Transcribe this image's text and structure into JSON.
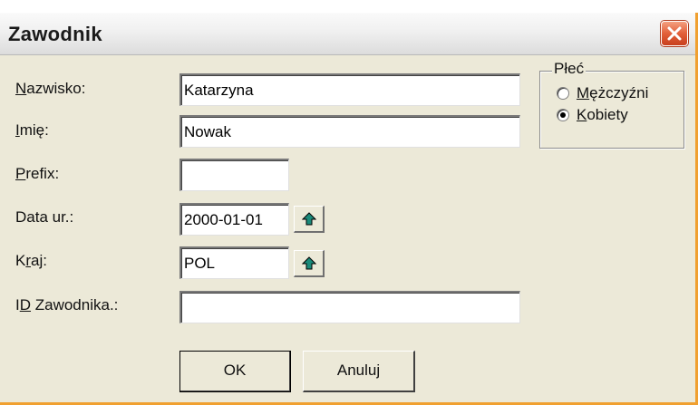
{
  "window": {
    "title": "Zawodnik"
  },
  "form": {
    "nazwisko": {
      "label_mnemonic": "N",
      "label_rest": "azwisko:",
      "value": "Katarzyna"
    },
    "imie": {
      "label_mnemonic": "I",
      "label_rest": "mię:",
      "value": "Nowak"
    },
    "prefix": {
      "label_mnemonic": "P",
      "label_rest": "refix:",
      "value": ""
    },
    "data_ur": {
      "label": "Data ur.:",
      "value": "2000-01-01"
    },
    "kraj": {
      "label_pre": "K",
      "label_mnemonic": "r",
      "label_rest": "aj:",
      "value": "POL"
    },
    "id_zawodnika": {
      "label_pre": "I",
      "label_mnemonic": "D",
      "label_rest": " Zawodnika.:",
      "value": ""
    }
  },
  "gender": {
    "title": "Płeć",
    "options": [
      {
        "pre": "",
        "mnemonic": "M",
        "rest": "ężczyźni",
        "selected": false
      },
      {
        "pre": "",
        "mnemonic": "K",
        "rest": "obiety",
        "selected": true
      }
    ]
  },
  "buttons": {
    "ok": "OK",
    "cancel": "Anuluj"
  },
  "colors": {
    "window_bg": "#ece9d8",
    "accent_border": "#f0a030",
    "close_button": "#e2603a",
    "arrow_icon": "#1a8a7a"
  },
  "icons": {
    "close": "close-icon",
    "spin_up": "arrow-up-icon"
  }
}
